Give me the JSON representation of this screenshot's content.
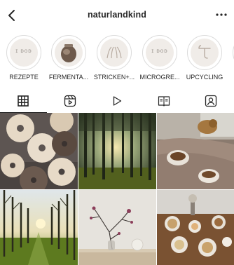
{
  "header": {
    "username": "naturlandkind"
  },
  "highlights": [
    {
      "label": "REZEPTE",
      "icon": "text-icon",
      "icon_text": "ɪ ᴅᴏᴅ"
    },
    {
      "label": "FERMENTA...",
      "icon": "jar-icon"
    },
    {
      "label": "STRICKEN+...",
      "icon": "hands-icon"
    },
    {
      "label": "MICROGRE...",
      "icon": "text-icon",
      "icon_text": "ɪ ᴅᴏᴅ"
    },
    {
      "label": "UPCYCLING",
      "icon": "hanger-icon"
    }
  ],
  "tabs": [
    {
      "name": "grid",
      "icon": "grid-icon"
    },
    {
      "name": "reels",
      "icon": "reels-icon"
    },
    {
      "name": "videos",
      "icon": "play-icon"
    },
    {
      "name": "guides",
      "icon": "guide-icon"
    },
    {
      "name": "tagged",
      "icon": "tagged-icon"
    }
  ],
  "posts": [
    {
      "subject": "bagels"
    },
    {
      "subject": "forest-sunlight"
    },
    {
      "subject": "dog-coffee-bed"
    },
    {
      "subject": "tree-avenue"
    },
    {
      "subject": "branches-vase"
    },
    {
      "subject": "breakfast-table"
    }
  ]
}
